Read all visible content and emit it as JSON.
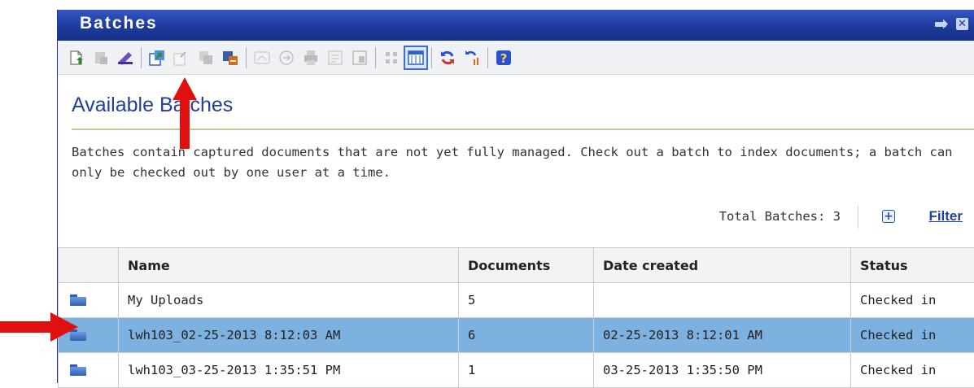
{
  "window": {
    "title": "Batches"
  },
  "toolbar": {
    "buttons": [
      {
        "icon": "new-batch-icon",
        "color": "#2f8a2a"
      },
      {
        "icon": "import-icon",
        "color": "#8a8f99"
      },
      {
        "icon": "scan-icon",
        "color": "#4b2a9a"
      },
      {
        "icon": "check-out-icon",
        "color": "#2f8a2a"
      },
      {
        "icon": "check-in-icon",
        "color": "#8a8f99"
      },
      {
        "icon": "copy-icon",
        "color": "#8a8f99"
      },
      {
        "icon": "delete-batch-icon",
        "color": "#d46a1a"
      },
      {
        "icon": "link-icon",
        "color": "#8a8f99"
      },
      {
        "icon": "route-icon",
        "color": "#8a8f99"
      },
      {
        "icon": "print-icon",
        "color": "#8a8f99"
      },
      {
        "icon": "properties-icon",
        "color": "#8a8f99"
      },
      {
        "icon": "export-icon",
        "color": "#8a8f99"
      },
      {
        "icon": "thumbnail-view-icon",
        "color": "#8a8f99"
      },
      {
        "icon": "details-view-icon",
        "color": "#2a63c8"
      },
      {
        "icon": "refresh-icon",
        "color": "#2a4fd0"
      },
      {
        "icon": "refresh-options-icon",
        "color": "#2a4fd0"
      },
      {
        "icon": "help-icon",
        "color": "#2a4fd0"
      }
    ]
  },
  "main": {
    "heading": "Available Batches",
    "description": "Batches contain captured documents that are not yet fully managed. Check out a batch to index documents; a batch can only be checked out by one user at a time.",
    "total_label": "Total Batches: 3",
    "filter_label": "Filter"
  },
  "table": {
    "headers": [
      "",
      "Name",
      "Documents",
      "Date created",
      "Status"
    ],
    "rows": [
      {
        "name": "My Uploads",
        "documents": "5",
        "date": "",
        "status": "Checked in",
        "selected": false
      },
      {
        "name": "lwh103_02-25-2013 8:12:03 AM",
        "documents": "6",
        "date": "02-25-2013 8:12:01 AM",
        "status": "Checked in",
        "selected": true
      },
      {
        "name": "lwh103_03-25-2013 1:35:51 PM",
        "documents": "1",
        "date": "03-25-2013 1:35:50 PM",
        "status": "Checked in",
        "selected": false
      }
    ]
  },
  "annotations": {
    "arrow_color": "#e01010"
  }
}
